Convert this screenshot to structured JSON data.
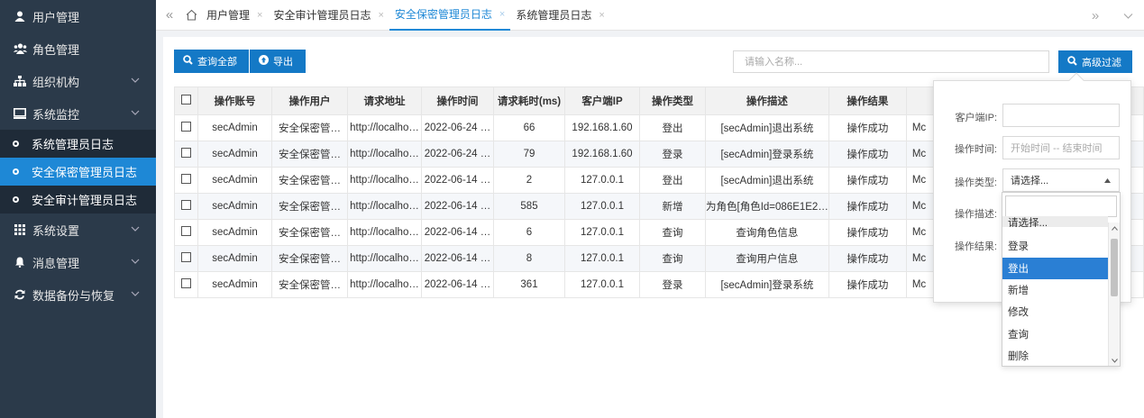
{
  "sidebar": {
    "items": [
      {
        "label": "用户管理",
        "icon": "user-icon"
      },
      {
        "label": "角色管理",
        "icon": "users-icon"
      },
      {
        "label": "组织机构",
        "icon": "sitemap-icon"
      },
      {
        "label": "系统监控",
        "icon": "monitor-icon"
      },
      {
        "label": "系统管理员日志"
      },
      {
        "label": "安全保密管理员日志"
      },
      {
        "label": "安全审计管理员日志"
      },
      {
        "label": "系统设置",
        "icon": "grid-icon"
      },
      {
        "label": "消息管理",
        "icon": "bell-icon"
      },
      {
        "label": "数据备份与恢复",
        "icon": "refresh-icon"
      }
    ]
  },
  "tabs": [
    {
      "label": "用户管理"
    },
    {
      "label": "安全审计管理员日志"
    },
    {
      "label": "安全保密管理员日志"
    },
    {
      "label": "系统管理员日志"
    }
  ],
  "toolbar": {
    "query_all": "查询全部",
    "export": "导出",
    "search_placeholder": "请输入名称...",
    "advanced_filter": "高级过滤"
  },
  "table": {
    "headers": [
      "操作账号",
      "操作用户",
      "请求地址",
      "操作时间",
      "请求耗时(ms)",
      "客户端IP",
      "操作类型",
      "操作描述",
      "操作结果"
    ],
    "rows": [
      [
        "secAdmin",
        "安全保密管…",
        "http://localho…",
        "2022-06-24 …",
        "66",
        "192.168.1.60",
        "登出",
        "[secAdmin]退出系统",
        "操作成功",
        "Mc"
      ],
      [
        "secAdmin",
        "安全保密管…",
        "http://localho…",
        "2022-06-24 …",
        "79",
        "192.168.1.60",
        "登录",
        "[secAdmin]登录系统",
        "操作成功",
        "Mc"
      ],
      [
        "secAdmin",
        "安全保密管…",
        "http://localho…",
        "2022-06-14 …",
        "2",
        "127.0.0.1",
        "登出",
        "[secAdmin]退出系统",
        "操作成功",
        "Mc"
      ],
      [
        "secAdmin",
        "安全保密管…",
        "http://localho…",
        "2022-06-14 …",
        "585",
        "127.0.0.1",
        "新增",
        "为角色[角色Id=086E1E2…",
        "操作成功",
        "Mc"
      ],
      [
        "secAdmin",
        "安全保密管…",
        "http://localho…",
        "2022-06-14 …",
        "6",
        "127.0.0.1",
        "查询",
        "查询角色信息",
        "操作成功",
        "Mc"
      ],
      [
        "secAdmin",
        "安全保密管…",
        "http://localho…",
        "2022-06-14 …",
        "8",
        "127.0.0.1",
        "查询",
        "查询用户信息",
        "操作成功",
        "Mc"
      ],
      [
        "secAdmin",
        "安全保密管…",
        "http://localho…",
        "2022-06-14 …",
        "361",
        "127.0.0.1",
        "登录",
        "[secAdmin]登录系统",
        "操作成功",
        "Mc"
      ]
    ]
  },
  "filter": {
    "client_ip_label": "客户端IP:",
    "op_time_label": "操作时间:",
    "op_time_placeholder": "开始时间 -- 结束时间",
    "op_type_label": "操作类型:",
    "op_type_value": "请选择...",
    "op_desc_label": "操作描述:",
    "op_result_label": "操作结果:",
    "options": [
      "请选择...",
      "登录",
      "登出",
      "新增",
      "修改",
      "查询",
      "删除"
    ],
    "highlighted": "登出"
  },
  "colors": {
    "primary": "#1479c6",
    "sidebar": "#2b3a4a",
    "active": "#1e88d6"
  }
}
